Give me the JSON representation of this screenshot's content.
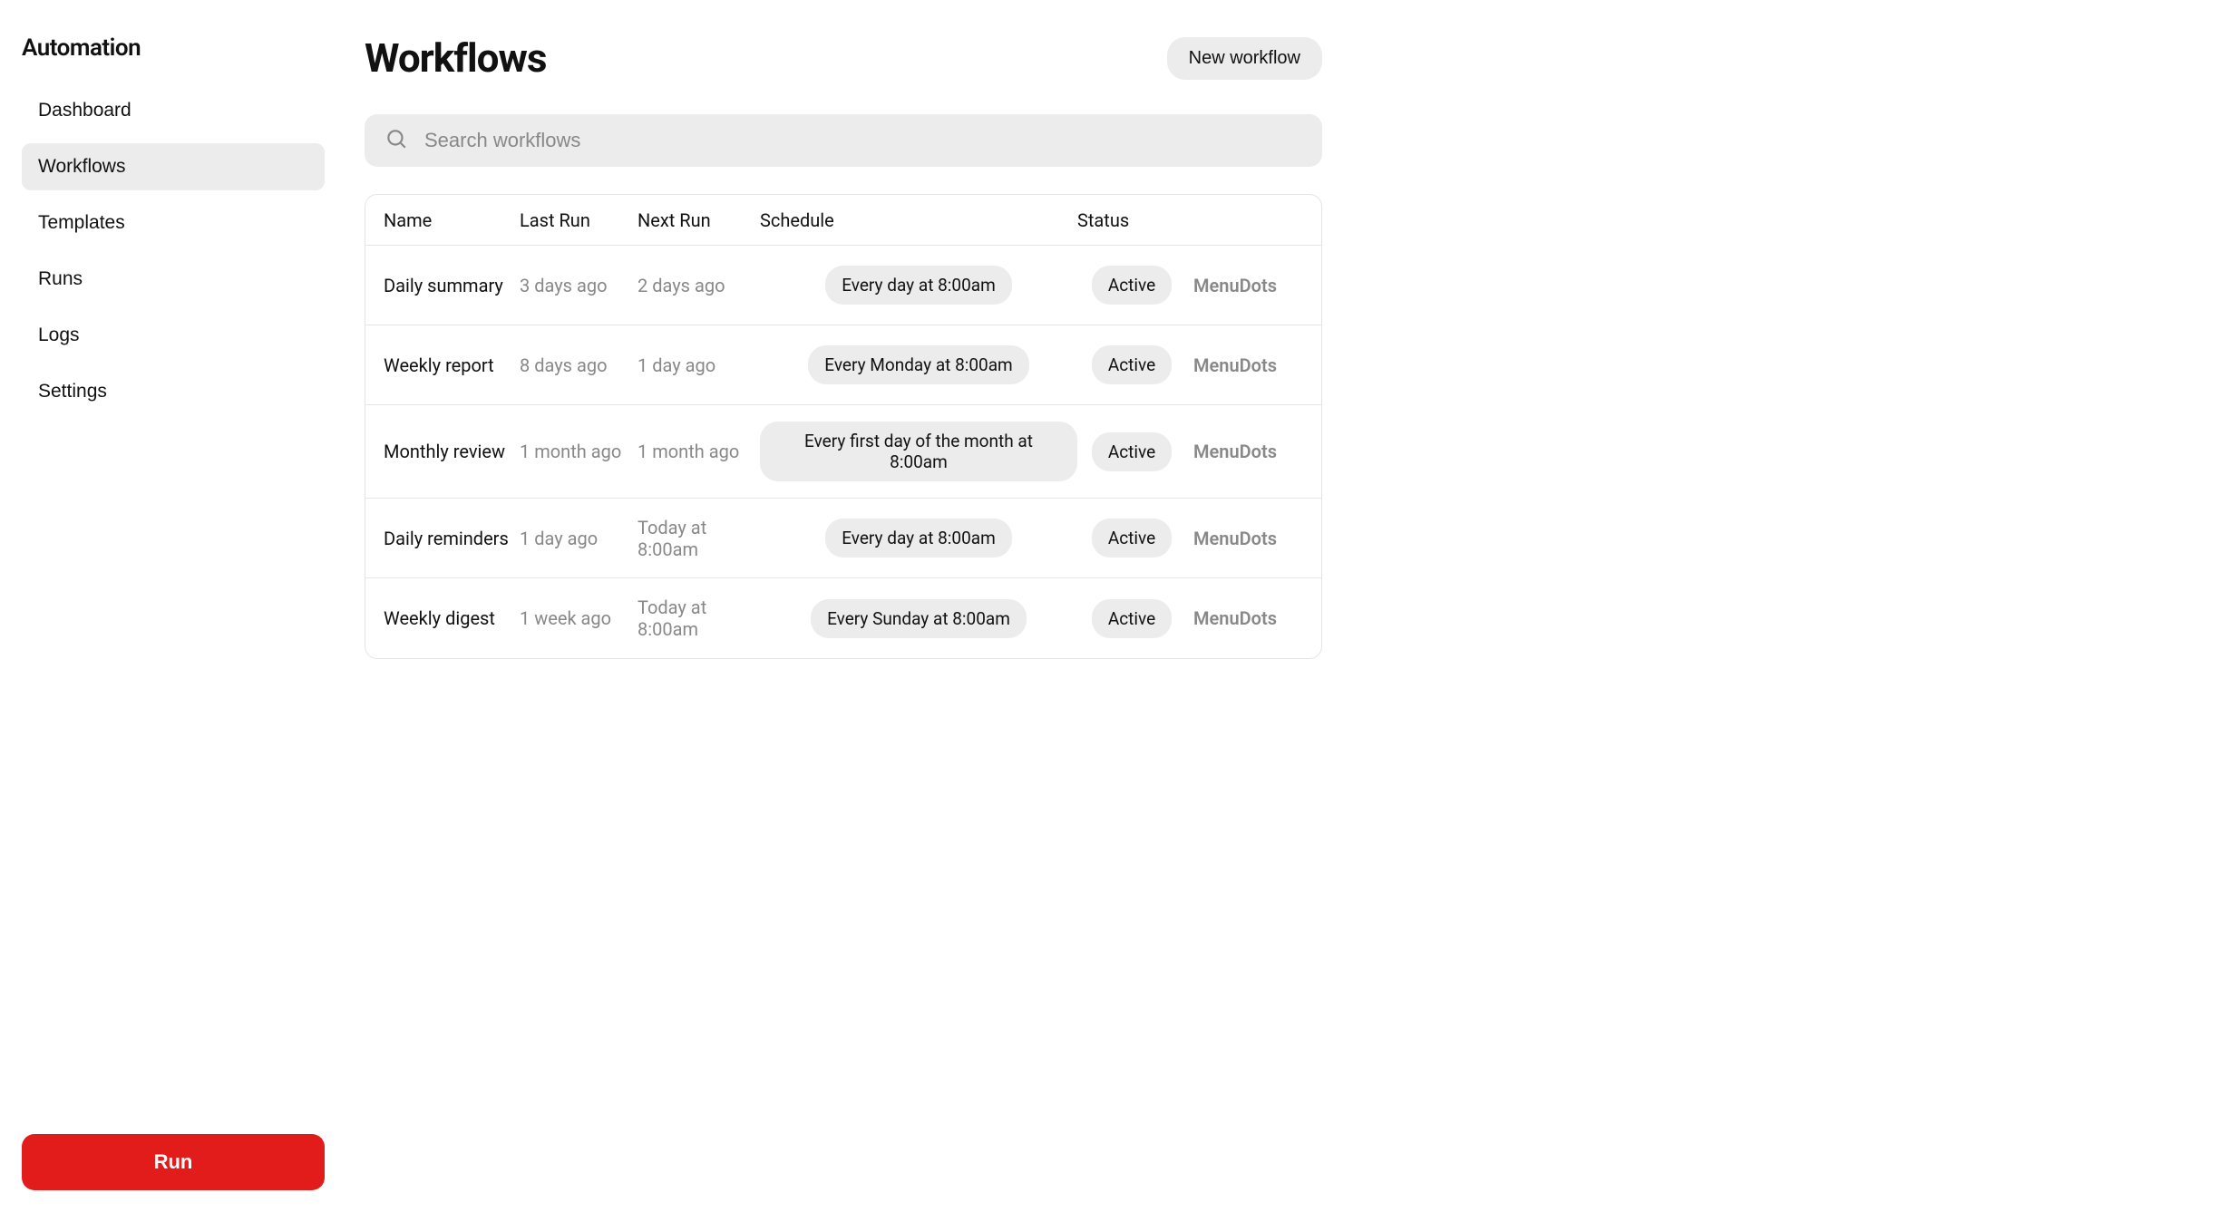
{
  "sidebar": {
    "title": "Automation",
    "items": [
      {
        "label": "Dashboard",
        "active": false
      },
      {
        "label": "Workflows",
        "active": true
      },
      {
        "label": "Templates",
        "active": false
      },
      {
        "label": "Runs",
        "active": false
      },
      {
        "label": "Logs",
        "active": false
      },
      {
        "label": "Settings",
        "active": false
      }
    ],
    "run_button": "Run"
  },
  "header": {
    "title": "Workflows",
    "new_button": "New workflow"
  },
  "search": {
    "placeholder": "Search workflows",
    "value": ""
  },
  "table": {
    "columns": [
      "Name",
      "Last Run",
      "Next Run",
      "Schedule",
      "Status",
      ""
    ],
    "menu_label": "MenuDots",
    "rows": [
      {
        "name": "Daily summary",
        "last_run": "3 days ago",
        "next_run": "2 days ago",
        "schedule": "Every day at 8:00am",
        "status": "Active"
      },
      {
        "name": "Weekly report",
        "last_run": "8 days ago",
        "next_run": "1 day ago",
        "schedule": "Every Monday at 8:00am",
        "status": "Active"
      },
      {
        "name": "Monthly review",
        "last_run": "1 month ago",
        "next_run": "1 month ago",
        "schedule": "Every first day of the month at 8:00am",
        "status": "Active"
      },
      {
        "name": "Daily reminders",
        "last_run": "1 day ago",
        "next_run": "Today at 8:00am",
        "schedule": "Every day at 8:00am",
        "status": "Active"
      },
      {
        "name": "Weekly digest",
        "last_run": "1 week ago",
        "next_run": "Today at 8:00am",
        "schedule": "Every Sunday at 8:00am",
        "status": "Active"
      }
    ]
  }
}
